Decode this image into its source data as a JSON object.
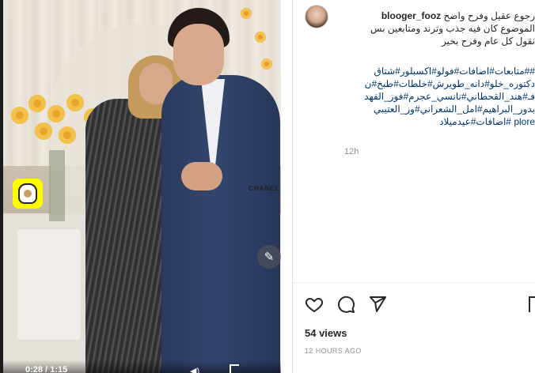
{
  "video": {
    "current_time": "0:28",
    "duration": "1:15",
    "time_separator": " / ",
    "brand_text": "CHANEL"
  },
  "post": {
    "username": "blooger_fooz",
    "caption_lines": [
      "رجوع عقيل وفرح واضح",
      "الموضوع كان فيه جذب وترند ومتابعين بس",
      "نقول كل عام وفرح بخير"
    ],
    "hashtag_lines": [
      "##متابعات#اضافات#فولو#اكسبلور#شتاق",
      "دكتوره_خلو#دانه_طويرش#خلطات#طبخ#ن",
      "فـ#هند_القحطاني#نانسي_عجرم#فوز_الفهد",
      "بدور_البراهيم#امل_الشعراني#وز_العتيبي",
      "plore #اضافات#عيدميلاد"
    ],
    "age": "12h",
    "views": "54 views",
    "posted": "12 HOURS AGO"
  },
  "icons": {
    "like": "heart-icon",
    "comment": "comment-icon",
    "share": "share-icon",
    "save": "bookmark-icon",
    "edit": "pencil-icon",
    "snapcode": "snapchat-icon",
    "volume": "volume-icon",
    "fullscreen": "fullscreen-icon"
  },
  "colors": {
    "text": "#262626",
    "hashtag": "#00376b",
    "muted": "#8e8e8e",
    "snap_yellow": "#fffc00"
  }
}
